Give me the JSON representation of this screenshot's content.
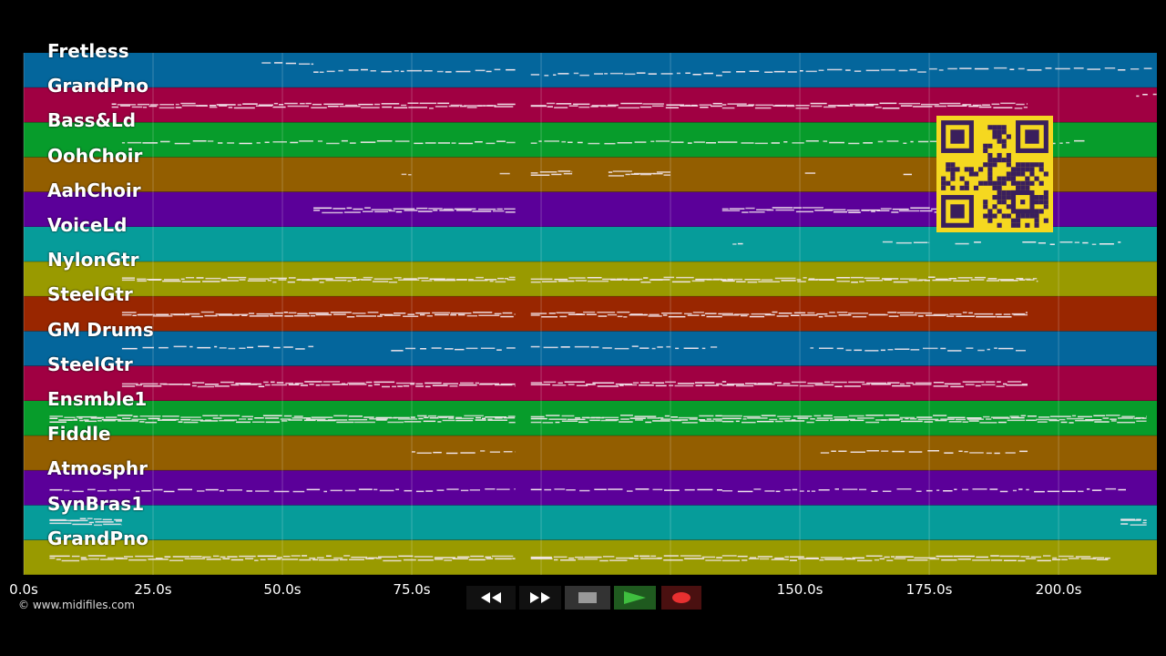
{
  "tracks": [
    {
      "name": "Fretless",
      "color": "#04669c",
      "notes": [
        [
          46,
          56,
          0.3,
          0
        ],
        [
          56,
          95,
          0.5,
          0
        ],
        [
          98,
          135,
          0.6,
          0
        ],
        [
          135,
          175,
          0.5,
          0
        ],
        [
          175,
          218,
          0.45,
          0
        ]
      ]
    },
    {
      "name": "GrandPno",
      "color": "#a00042",
      "notes": [
        [
          17,
          95,
          0.5,
          1
        ],
        [
          98,
          135,
          0.5,
          1
        ],
        [
          135,
          194,
          0.5,
          1
        ],
        [
          215,
          219,
          0.2,
          0
        ]
      ]
    },
    {
      "name": "Bass&Ld",
      "color": "#079c2b",
      "notes": [
        [
          19,
          95,
          0.55,
          0
        ],
        [
          98,
          135,
          0.55,
          0
        ],
        [
          135,
          205,
          0.55,
          0
        ]
      ]
    },
    {
      "name": "OohChoir",
      "color": "#935e00",
      "notes": [
        [
          73,
          75,
          0.45,
          0
        ],
        [
          92,
          94,
          0.45,
          0
        ],
        [
          98,
          106,
          0.45,
          1
        ],
        [
          113,
          125,
          0.45,
          1
        ],
        [
          151,
          153,
          0.45,
          0
        ],
        [
          170,
          172,
          0.45,
          0
        ]
      ]
    },
    {
      "name": "AahChoir",
      "color": "#5b0099",
      "notes": [
        [
          56,
          95,
          0.5,
          1
        ],
        [
          135,
          180,
          0.5,
          1
        ]
      ]
    },
    {
      "name": "VoiceLd",
      "color": "#069c9a",
      "notes": [
        [
          137,
          139,
          0.45,
          0
        ],
        [
          166,
          175,
          0.45,
          0
        ],
        [
          180,
          185,
          0.45,
          0
        ],
        [
          193,
          212,
          0.45,
          0
        ]
      ]
    },
    {
      "name": "NylonGtr",
      "color": "#999a00",
      "notes": [
        [
          19,
          95,
          0.5,
          1
        ],
        [
          98,
          135,
          0.5,
          1
        ],
        [
          135,
          196,
          0.5,
          1
        ]
      ]
    },
    {
      "name": "SteelGtr",
      "color": "#992600",
      "notes": [
        [
          19,
          95,
          0.5,
          1
        ],
        [
          98,
          135,
          0.5,
          1
        ],
        [
          135,
          194,
          0.5,
          1
        ]
      ]
    },
    {
      "name": "GM Drums",
      "color": "#04669c",
      "notes": [
        [
          19,
          56,
          0.45,
          0
        ],
        [
          71,
          95,
          0.5,
          0
        ],
        [
          98,
          134,
          0.45,
          0
        ],
        [
          152,
          194,
          0.5,
          0
        ]
      ]
    },
    {
      "name": "SteelGtr",
      "color": "#a00042",
      "notes": [
        [
          19,
          95,
          0.5,
          1
        ],
        [
          98,
          135,
          0.5,
          1
        ],
        [
          135,
          194,
          0.5,
          1
        ]
      ]
    },
    {
      "name": "Ensmble1",
      "color": "#079c2b",
      "notes": [
        [
          5,
          95,
          0.5,
          2
        ],
        [
          98,
          135,
          0.5,
          2
        ],
        [
          135,
          217,
          0.5,
          2
        ]
      ]
    },
    {
      "name": "Fiddle",
      "color": "#935e00",
      "notes": [
        [
          75,
          95,
          0.45,
          0
        ],
        [
          154,
          194,
          0.45,
          0
        ]
      ]
    },
    {
      "name": "Atmosphr",
      "color": "#5b0099",
      "notes": [
        [
          5,
          95,
          0.55,
          0
        ],
        [
          98,
          135,
          0.55,
          0
        ],
        [
          135,
          213,
          0.55,
          0
        ]
      ]
    },
    {
      "name": "SynBras1",
      "color": "#069c9a",
      "notes": [
        [
          5,
          19,
          0.45,
          2
        ],
        [
          212,
          217,
          0.45,
          2
        ]
      ]
    },
    {
      "name": "GrandPno",
      "color": "#999a00",
      "notes": [
        [
          5,
          95,
          0.5,
          1
        ],
        [
          98,
          135,
          0.5,
          1
        ],
        [
          135,
          210,
          0.5,
          1
        ]
      ]
    }
  ],
  "time_axis": {
    "min": 0,
    "max": 219,
    "ticks": [
      {
        "value": 0,
        "label": "0.0s"
      },
      {
        "value": 25,
        "label": "25.0s"
      },
      {
        "value": 50,
        "label": "50.0s"
      },
      {
        "value": 75,
        "label": "75.0s"
      },
      {
        "value": 150,
        "label": "150.0s"
      },
      {
        "value": 175,
        "label": "175.0s"
      },
      {
        "value": 200,
        "label": "200.0s"
      }
    ],
    "gridlines": [
      0,
      25,
      50,
      75,
      100,
      125,
      150,
      175,
      200
    ]
  },
  "copyright": "© www.midifiles.com",
  "transport": {
    "rewind_icon": "rewind-icon",
    "fast_forward_icon": "fast-forward-icon",
    "stop_icon": "stop-icon",
    "play_icon": "play-icon",
    "record_icon": "record-icon",
    "play_color": "#3fbf3f",
    "record_color": "#e83030"
  },
  "qr_icon": "qr-code-icon",
  "qr_color": "#f5d820"
}
